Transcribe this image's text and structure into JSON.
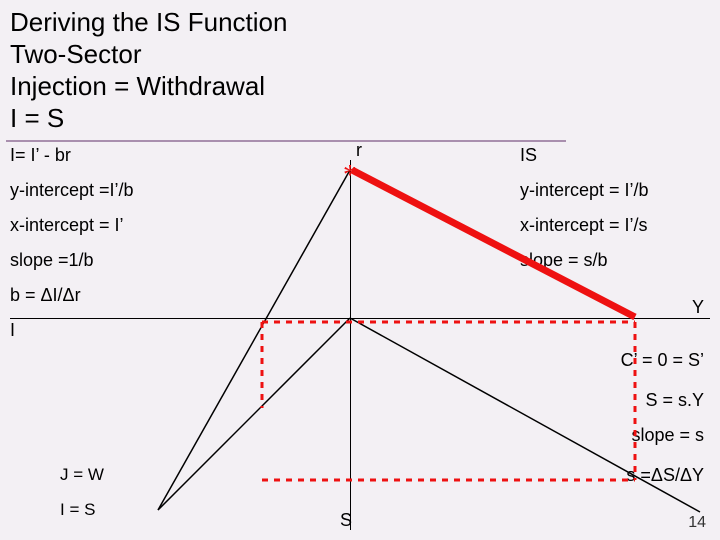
{
  "title": {
    "line1": "Deriving the IS Function",
    "line2": "Two-Sector",
    "line3": "Injection = Withdrawal",
    "line4": "I = S"
  },
  "left": {
    "eq": "I= I’ - br",
    "yint": "y-intercept =I’/b",
    "xint": "x-intercept = I’",
    "slope": "slope =1/b",
    "b": "b = ΔI/Δr",
    "I": "I",
    "JW": "J = W",
    "IS": "I = S"
  },
  "right": {
    "IS": "IS",
    "yint": "y-intercept = I’/b",
    "xint": "x-intercept = I’/s",
    "slope": "slope = s/b",
    "Y": "Y",
    "C": "C’ = 0 = S’",
    "S": "S = s.Y",
    "slope_s": "slope = s",
    "sdelta": "s =ΔS/ΔY"
  },
  "axis": {
    "r": "r",
    "S": "S"
  },
  "slide_number": "14",
  "chart_data": {
    "type": "diagram",
    "title": "Deriving the IS Function (Two-Sector, Injection = Withdrawal, I = S)",
    "description": "Four-quadrant derivation diagram with vertical r/S axis and horizontal I/Y axis. Upper-left quadrant: investment line I = I' - br. Upper-right quadrant: IS curve (highlighted). Lower-right quadrant: saving line S = s·Y. Lower-left quadrant: 45° J=W (I=S) line. Dashed red construction lines link the quadrants.",
    "axes": {
      "vertical_up": "r",
      "vertical_down": "S",
      "horizontal_left": "I",
      "horizontal_right": "Y"
    },
    "quadrants": {
      "upper_left": {
        "relation": "I = I' - br",
        "y_intercept": "I'/b",
        "x_intercept": "I'",
        "slope": "1/b"
      },
      "upper_right": {
        "relation": "IS",
        "y_intercept": "I'/b",
        "x_intercept": "I'/s",
        "slope": "s/b",
        "highlighted": true
      },
      "lower_right": {
        "relation": "S = s·Y",
        "intercept": "C' = 0 = S'",
        "slope": "s",
        "slope_def": "s = ΔS/ΔY"
      },
      "lower_left": {
        "relation": "J = W  (I = S)",
        "note": "45° line"
      }
    },
    "parameter_definitions": {
      "b": "ΔI/Δr"
    }
  }
}
